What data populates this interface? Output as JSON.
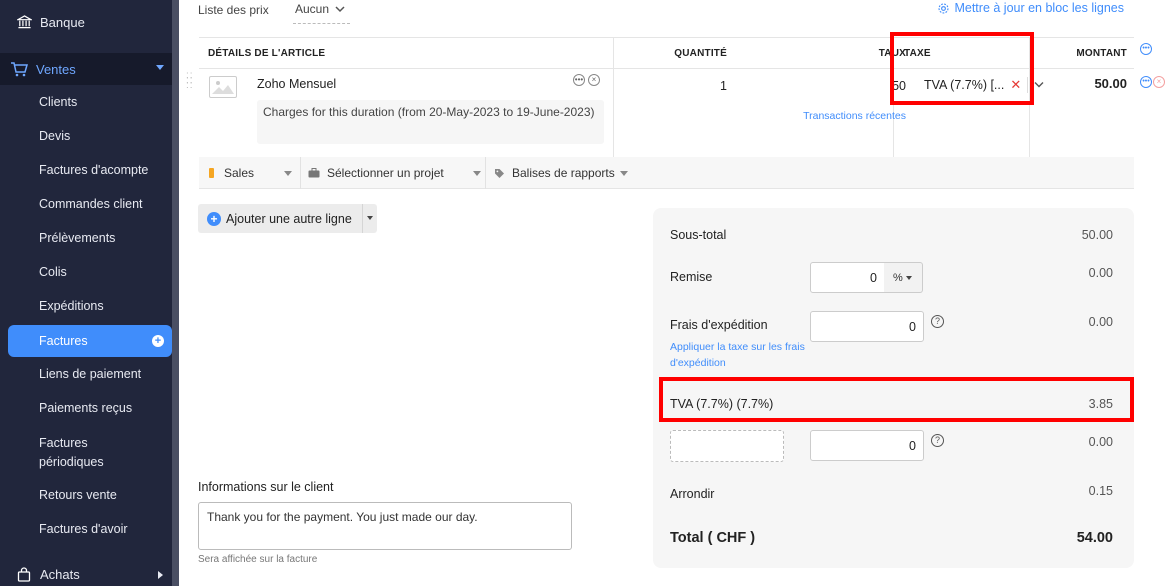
{
  "sidebar": {
    "top_item": "Banque",
    "section": "Ventes",
    "items": [
      "Clients",
      "Devis",
      "Factures d'acompte",
      "Commandes client",
      "Prélèvements",
      "Colis",
      "Expéditions",
      "Factures",
      "Liens de paiement",
      "Paiements reçus",
      "Factures périodiques",
      "Retours vente",
      "Factures d'avoir"
    ],
    "active_item": "Factures",
    "bottom_item": "Achats"
  },
  "header": {
    "pricelist_label": "Liste des prix",
    "pricelist_value": "Aucun",
    "bulk_update_link": "Mettre à jour en bloc les lignes"
  },
  "table": {
    "columns": [
      "DÉTAILS DE L'ARTICLE",
      "QUANTITÉ",
      "TAUX",
      "TAXE",
      "MONTANT"
    ],
    "row": {
      "item_name": "Zoho Mensuel",
      "description": "Charges for this duration (from 20-May-2023 to 19-June-2023)",
      "quantity": "1",
      "rate": "50",
      "recent_transactions": "Transactions récentes",
      "tax": "TVA (7.7%) [...",
      "amount": "50.00"
    }
  },
  "tags": {
    "account": "Sales",
    "project": "Sélectionner un projet",
    "reporting_tags": "Balises de rapports"
  },
  "add_line_button": "Ajouter une autre ligne",
  "customer_notes": {
    "label": "Informations sur le client",
    "value": "Thank you for the payment. You just made our day.",
    "hint": "Sera affichée sur la facture"
  },
  "totals": {
    "subtotal_label": "Sous-total",
    "subtotal_value": "50.00",
    "discount_label": "Remise",
    "discount_input": "0",
    "discount_unit": "%",
    "discount_value": "0.00",
    "shipping_label": "Frais d'expédition",
    "shipping_input": "0",
    "shipping_value": "0.00",
    "shipping_tax_link": "Appliquer la taxe sur les frais d'expédition",
    "tax_label": "TVA (7.7%) (7.7%)",
    "tax_value": "3.85",
    "adjustment_input": "0",
    "adjustment_value": "0.00",
    "rounding_label": "Arrondir",
    "rounding_value": "0.15",
    "total_label": "Total ( CHF )",
    "total_value": "54.00"
  },
  "colors": {
    "sidebar_bg": "#21263c",
    "accent": "#408dfb",
    "highlight": "#ff0000"
  }
}
